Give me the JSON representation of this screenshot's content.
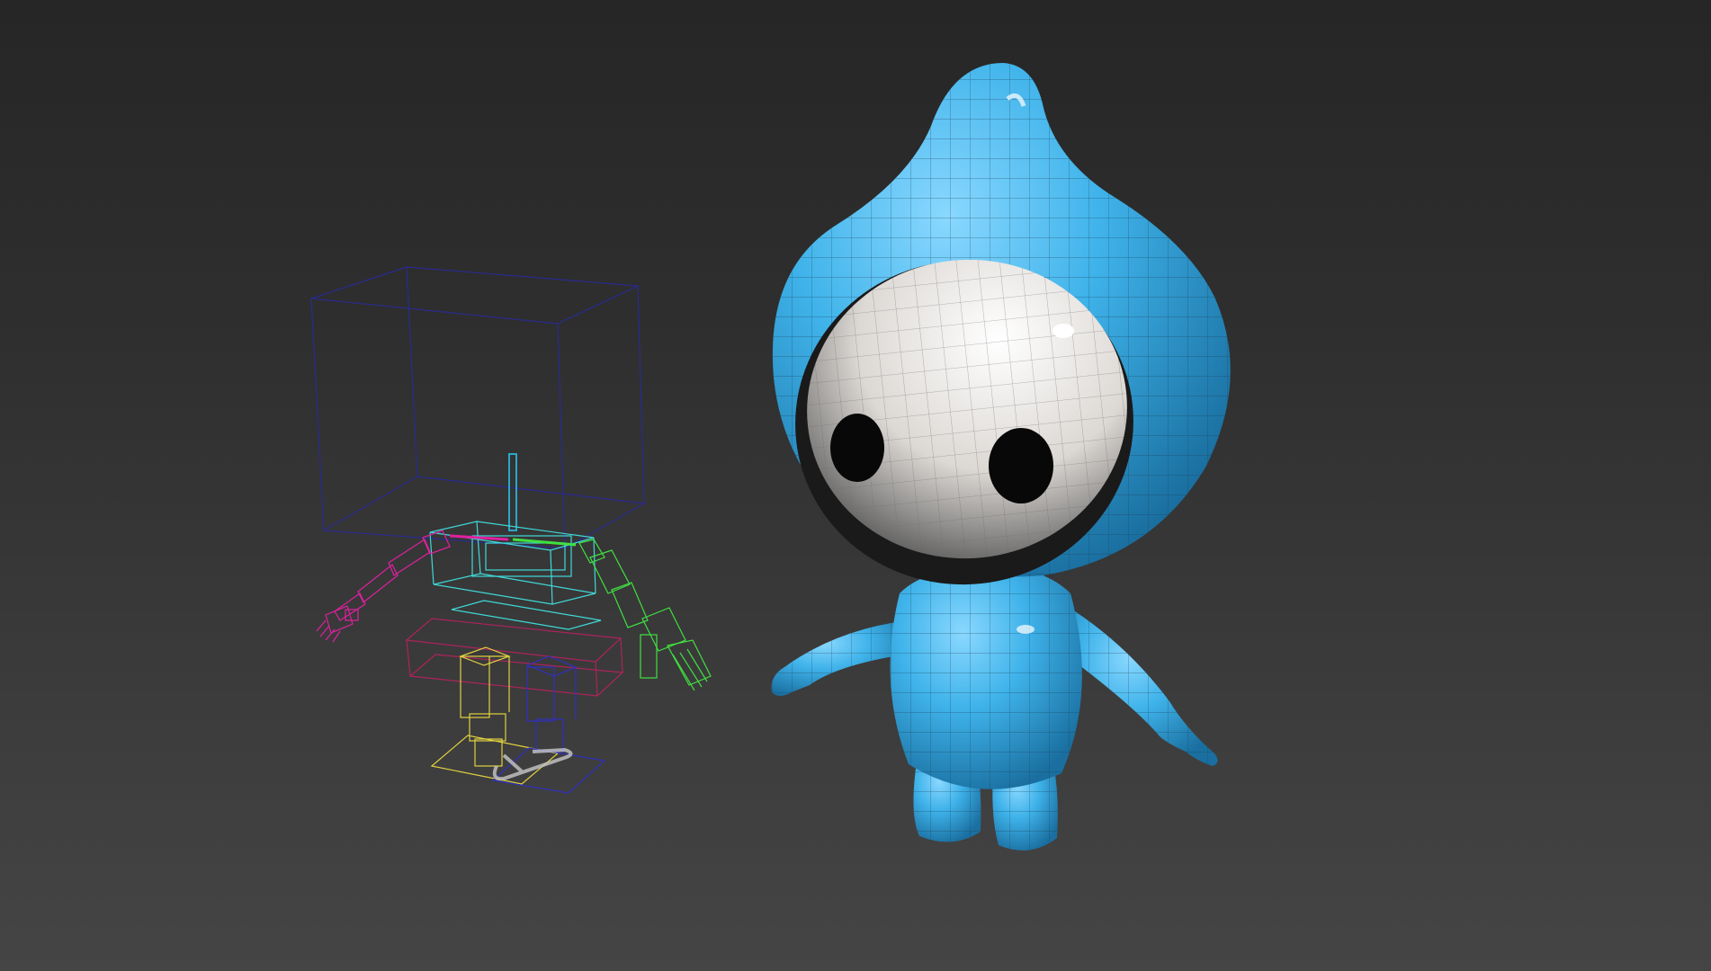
{
  "viewport": {
    "label": "",
    "background_top": "#262626",
    "background_bottom": "#454545"
  },
  "scene": {
    "objects": [
      {
        "name": "biped-rig",
        "kind": "wireframe bounding boxes"
      },
      {
        "name": "blue-droplet-character",
        "kind": "shaded mesh with wireframe overlay"
      }
    ],
    "colors": {
      "head_box": "#2a2a90",
      "spine": "#2aa8c8",
      "pelvis_box": "#40d8d8",
      "left_arm": "#e020a0",
      "right_arm": "#40e040",
      "left_leg": "#e0d040",
      "right_leg": "#3030c0",
      "hips": "#c02060",
      "footsteps": "#c8c8c8",
      "character_body": "#3fb3ea",
      "character_face": "#f2f0ee",
      "character_eyes": "#080808"
    }
  }
}
